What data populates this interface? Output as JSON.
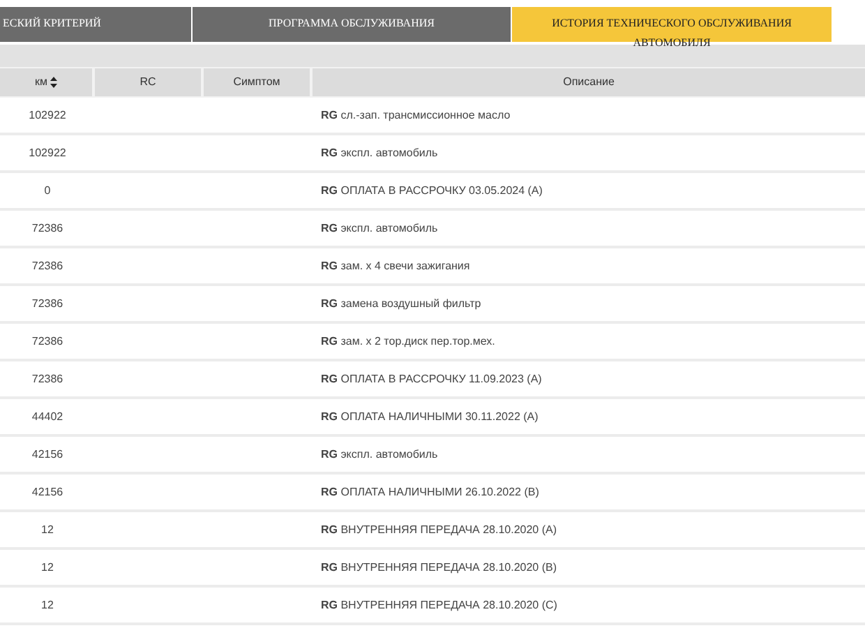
{
  "tabs": [
    {
      "label": "ЕСКИЙ КРИТЕРИЙ",
      "selected": false
    },
    {
      "label": "ПРОГРАММА ОБСЛУЖИВАНИЯ",
      "selected": false
    },
    {
      "label": "ИСТОРИЯ ТЕХНИЧЕСКОГО ОБСЛУЖИВАНИЯ АВТОМОБИЛЯ",
      "selected": true
    }
  ],
  "table": {
    "columns": [
      {
        "label": "км",
        "sortable": true
      },
      {
        "label": "RC",
        "sortable": false
      },
      {
        "label": "Симптом",
        "sortable": false
      },
      {
        "label": "Описание",
        "sortable": false
      }
    ],
    "rows": [
      {
        "km": "102922",
        "description": "**RG** сл.-зап. трансмиссионное масло"
      },
      {
        "km": "102922",
        "description": "**RG** экспл. автомобиль"
      },
      {
        "km": "0",
        "description": "**RG** ОПЛАТА В РАССРОЧКУ 03.05.2024 (A)"
      },
      {
        "km": "72386",
        "description": "**RG** экспл. автомобиль"
      },
      {
        "km": "72386",
        "description": "**RG** зам. x 4 свечи зажигания"
      },
      {
        "km": "72386",
        "description": "**RG** замена воздушный фильтр"
      },
      {
        "km": "72386",
        "description": "**RG** зам. x 2 тор.диск пер.тор.мех."
      },
      {
        "km": "72386",
        "description": "**RG** ОПЛАТА В РАССРОЧКУ 11.09.2023 (A)"
      },
      {
        "km": "44402",
        "description": "**RG** ОПЛАТА НАЛИЧНЫМИ 30.11.2022 (A)"
      },
      {
        "km": "42156",
        "description": "**RG** экспл. автомобиль"
      },
      {
        "km": "42156",
        "description": "**RG** ОПЛАТА НАЛИЧНЫМИ 26.10.2022 (B)"
      },
      {
        "km": "12",
        "description": "**RG** ВНУТРЕННЯЯ ПЕРЕДАЧА 28.10.2020 (A)"
      },
      {
        "km": "12",
        "description": "**RG** ВНУТРЕННЯЯ ПЕРЕДАЧА 28.10.2020 (B)"
      },
      {
        "km": "12",
        "description": "**RG** ВНУТРЕННЯЯ ПЕРЕДАЧА 28.10.2020 (C)"
      }
    ]
  }
}
